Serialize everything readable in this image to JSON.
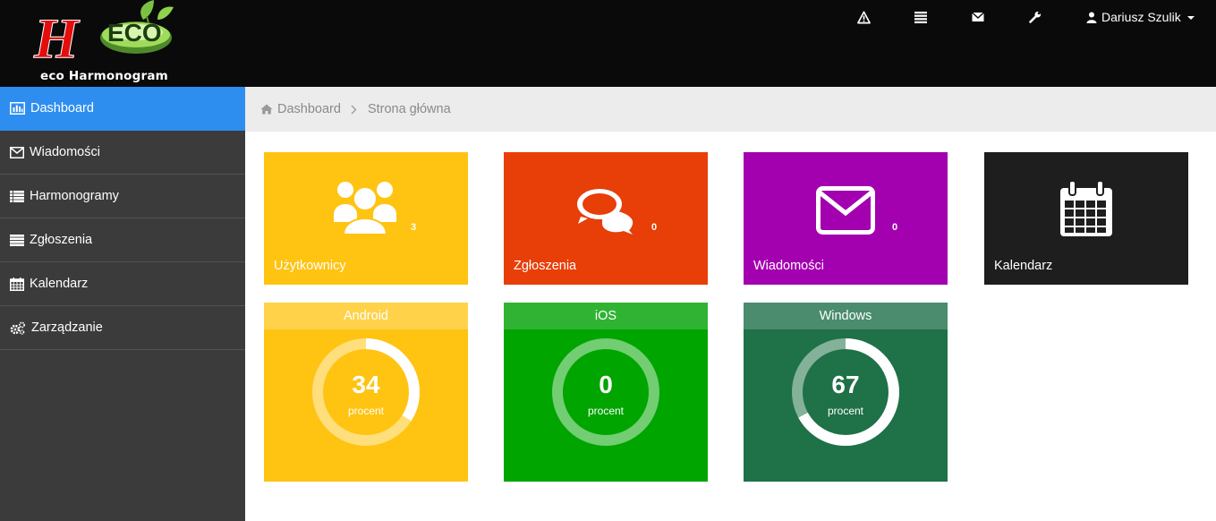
{
  "brand": {
    "logo_letter": "H",
    "logo_text": "ECO",
    "caption": "eco Harmonogram"
  },
  "topbar": {
    "icons": [
      "warning-icon",
      "list-icon",
      "envelope-icon",
      "wrench-icon"
    ],
    "user_name": "Dariusz Szulik"
  },
  "sidebar": {
    "items": [
      {
        "label": "Dashboard",
        "icon": "bar-chart-icon",
        "active": true
      },
      {
        "label": "Wiadomości",
        "icon": "envelope-icon"
      },
      {
        "label": "Harmonogramy",
        "icon": "list-icon"
      },
      {
        "label": "Zgłoszenia",
        "icon": "list-icon"
      },
      {
        "label": "Kalendarz",
        "icon": "calendar-icon"
      },
      {
        "label": "Zarządzanie",
        "icon": "gears-icon"
      }
    ]
  },
  "breadcrumb": {
    "home": "Dashboard",
    "current": "Strona główna"
  },
  "tiles": [
    {
      "label": "Użytkownicy",
      "count": "3",
      "icon": "users-icon",
      "color": "#ffc312"
    },
    {
      "label": "Zgłoszenia",
      "count": "0",
      "icon": "comments-icon",
      "color": "#e83e08"
    },
    {
      "label": "Wiadomości",
      "count": "0",
      "icon": "envelope-icon",
      "color": "#a300b0"
    },
    {
      "label": "Kalendarz",
      "icon": "calendar-icon",
      "color": "#1e1e1e"
    }
  ],
  "stats": [
    {
      "title": "Android",
      "value": "34",
      "unit": "procent",
      "percent": 34,
      "head_color": "#ffd24a",
      "body_color": "#ffc312"
    },
    {
      "title": "iOS",
      "value": "0",
      "unit": "procent",
      "percent": 0,
      "head_color": "#30b333",
      "body_color": "#00a500"
    },
    {
      "title": "Windows",
      "value": "67",
      "unit": "procent",
      "percent": 67,
      "head_color": "#4a8c6d",
      "body_color": "#1f7147"
    }
  ]
}
